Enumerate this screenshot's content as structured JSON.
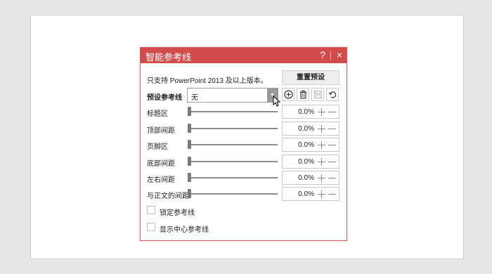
{
  "dialog": {
    "title": "智能参考线",
    "help_icon": "?",
    "close_icon": "×",
    "info_text": "只支持 PowerPoint 2013 及以上版本。",
    "reset_label": "重置预设",
    "preset_label": "预设参考线",
    "preset_value": "无",
    "dropdown_icon": "▼",
    "tool_icons": [
      "add-circle-icon",
      "trash-icon",
      "save-icon",
      "undo-icon"
    ],
    "rows": [
      {
        "label": "标题区",
        "value": "0.0%"
      },
      {
        "label": "顶部间距",
        "value": "0.0%"
      },
      {
        "label": "页脚区",
        "value": "0.0%"
      },
      {
        "label": "底部间距",
        "value": "0.0%"
      },
      {
        "label": "左右间距",
        "value": "0.0%"
      },
      {
        "label": "与正文的间距",
        "value": "0.0%"
      }
    ],
    "checkboxes": [
      {
        "label": "锁定参考线",
        "checked": false
      },
      {
        "label": "显示中心参考线",
        "checked": false
      }
    ]
  },
  "colors": {
    "titlebar": "#d24c4c",
    "border": "#d65b5b"
  }
}
